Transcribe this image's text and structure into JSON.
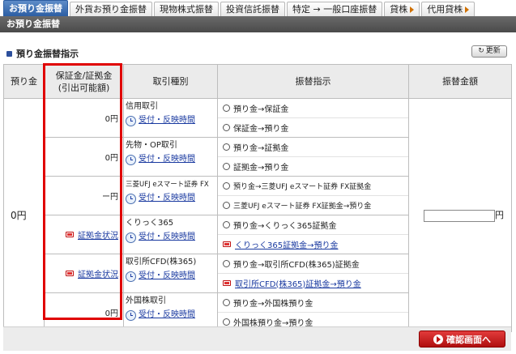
{
  "tabs": [
    {
      "label": "お預り金振替",
      "active": true
    },
    {
      "label": "外貨お預り金振替",
      "active": false
    },
    {
      "label": "現物株式振替",
      "active": false
    },
    {
      "label": "投資信託振替",
      "active": false
    },
    {
      "label": "特定 → 一般口座振替",
      "active": false
    },
    {
      "label": "貸株",
      "active": false
    },
    {
      "label": "代用貸株",
      "active": false
    }
  ],
  "header": {
    "title": "お預り金振替"
  },
  "section": {
    "title": "預り金振替指示",
    "refresh_label": "更新"
  },
  "table": {
    "headers": {
      "balance": "預り金",
      "margin_line1": "保証金/証拠金",
      "margin_line2": "(引出可能額)",
      "type": "取引種別",
      "instruction": "振替指示",
      "amount": "振替金額"
    },
    "balance_value": "0円",
    "amount_unit": "円",
    "rows": [
      {
        "margin": "0円",
        "type": "信用取引",
        "link": "受付・反映時間",
        "options": [
          "預り金→保証金",
          "保証金→預り金"
        ]
      },
      {
        "margin": "0円",
        "type": "先物・OP取引",
        "link": "受付・反映時間",
        "options": [
          "預り金→証拠金",
          "証拠金→預り金"
        ]
      },
      {
        "margin": "ー円",
        "type": "三菱UFJ eスマート証券 FX",
        "link": "受付・反映時間",
        "options": [
          "預り金→三菱UFJ eスマート証券 FX証拠金",
          "三菱UFJ eスマート証券 FX証拠金→預り金"
        ]
      },
      {
        "margin_link": "証拠金状況",
        "type": "くりっく365",
        "link": "受付・反映時間",
        "options": [
          "預り金→くりっく365証拠金"
        ],
        "link_option": "くりっく365証拠金→預り金"
      },
      {
        "margin_link": "証拠金状況",
        "type": "取引所CFD(株365)",
        "link": "受付・反映時間",
        "options": [
          "預り金→取引所CFD(株365)証拠金"
        ],
        "link_option": "取引所CFD(株365)証拠金→預り金"
      },
      {
        "margin": "0円",
        "type": "外国株取引",
        "link": "受付・反映時間",
        "options": [
          "預り金→外国株預り金",
          "外国株預り金→預り金"
        ]
      }
    ]
  },
  "footer": {
    "confirm_label": "確認画面へ"
  }
}
